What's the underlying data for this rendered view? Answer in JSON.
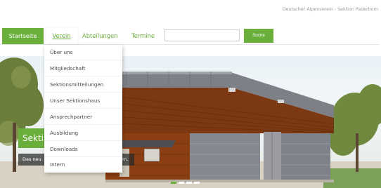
{
  "header": {
    "org_name": "Deutscher Alpenverein - Sektion Paderborn"
  },
  "nav": {
    "home": "Startseite",
    "verein": "Verein",
    "abteilungen": "Abteilungen",
    "termine": "Termine"
  },
  "search": {
    "value": "",
    "button": "Suche"
  },
  "dropdown": {
    "items": [
      "Über uns",
      "Mitgliedschaft",
      "Sektionsmitteilungen",
      "Unser Sektionshaus",
      "Ansprechpartner",
      "Ausbildung",
      "Downloads",
      "Intern"
    ]
  },
  "hero": {
    "title": "Sekti",
    "subtitle": "Das neu",
    "subtitle_tail": "m."
  },
  "slider": {
    "count": 4,
    "active": 0
  },
  "colors": {
    "brand_green": "#6aae3c",
    "text_gray": "#4a4a4a"
  }
}
